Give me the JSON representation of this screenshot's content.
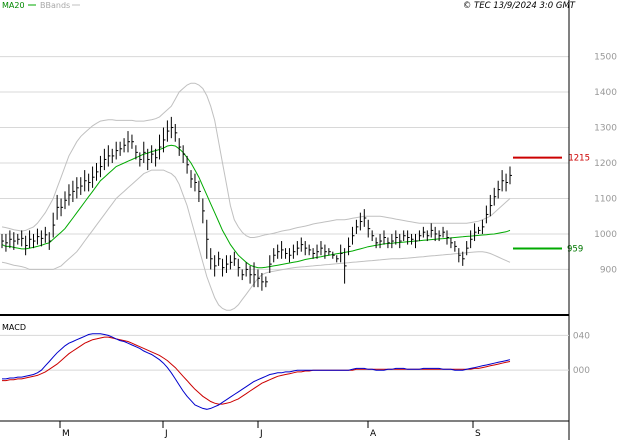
{
  "header": {
    "indicator_ma": "MA20",
    "indicator_bb": "BBands",
    "copyright": "© TEC 13/9/2024 3:0 GMT"
  },
  "price_axis": {
    "labels": [
      "1500",
      "1400",
      "1300",
      "1200",
      "1100",
      "1000",
      "900"
    ]
  },
  "markers": {
    "resistance_label": "1215",
    "support_label": "959",
    "resistance_color": "#cc0000",
    "support_color": "#00aa00"
  },
  "macd": {
    "label": "MACD",
    "axis_labels": [
      "040",
      "000"
    ]
  },
  "time_axis": {
    "labels": [
      "M",
      "J",
      "J",
      "A",
      "S"
    ]
  },
  "colors": {
    "ma20": "#00aa00",
    "bbands": "#c0c0c0",
    "macd_line": "#0000cc",
    "signal_line": "#cc0000",
    "bars": "#000000",
    "grid": "#d8d8d8"
  },
  "chart_data": {
    "type": "line",
    "title": "",
    "price_series_ohlc": [
      [
        1000,
        960
      ],
      [
        1000,
        950
      ],
      [
        1010,
        960
      ],
      [
        1005,
        955
      ],
      [
        1000,
        970
      ],
      [
        1010,
        965
      ],
      [
        995,
        940
      ],
      [
        1010,
        960
      ],
      [
        1000,
        960
      ],
      [
        1015,
        970
      ],
      [
        1010,
        965
      ],
      [
        1020,
        975
      ],
      [
        1005,
        955
      ],
      [
        1060,
        990
      ],
      [
        1110,
        1040
      ],
      [
        1100,
        1050
      ],
      [
        1120,
        1070
      ],
      [
        1140,
        1080
      ],
      [
        1150,
        1090
      ],
      [
        1160,
        1100
      ],
      [
        1160,
        1110
      ],
      [
        1180,
        1120
      ],
      [
        1170,
        1120
      ],
      [
        1190,
        1130
      ],
      [
        1200,
        1150
      ],
      [
        1220,
        1160
      ],
      [
        1240,
        1180
      ],
      [
        1250,
        1190
      ],
      [
        1240,
        1200
      ],
      [
        1260,
        1210
      ],
      [
        1260,
        1220
      ],
      [
        1270,
        1230
      ],
      [
        1290,
        1230
      ],
      [
        1280,
        1240
      ],
      [
        1250,
        1210
      ],
      [
        1230,
        1190
      ],
      [
        1260,
        1200
      ],
      [
        1240,
        1180
      ],
      [
        1250,
        1200
      ],
      [
        1240,
        1190
      ],
      [
        1280,
        1210
      ],
      [
        1300,
        1230
      ],
      [
        1320,
        1260
      ],
      [
        1330,
        1270
      ],
      [
        1310,
        1260
      ],
      [
        1270,
        1220
      ],
      [
        1250,
        1200
      ],
      [
        1220,
        1170
      ],
      [
        1180,
        1130
      ],
      [
        1170,
        1120
      ],
      [
        1150,
        1090
      ],
      [
        1100,
        1030
      ],
      [
        1040,
        930
      ],
      [
        960,
        900
      ],
      [
        940,
        880
      ],
      [
        950,
        910
      ],
      [
        930,
        880
      ],
      [
        940,
        890
      ],
      [
        940,
        900
      ],
      [
        950,
        910
      ],
      [
        930,
        880
      ],
      [
        900,
        870
      ],
      [
        920,
        880
      ],
      [
        910,
        860
      ],
      [
        920,
        850
      ],
      [
        900,
        850
      ],
      [
        890,
        840
      ],
      [
        880,
        850
      ],
      [
        940,
        890
      ],
      [
        960,
        920
      ],
      [
        970,
        930
      ],
      [
        980,
        930
      ],
      [
        960,
        930
      ],
      [
        960,
        920
      ],
      [
        970,
        930
      ],
      [
        980,
        940
      ],
      [
        990,
        950
      ],
      [
        980,
        940
      ],
      [
        970,
        940
      ],
      [
        960,
        930
      ],
      [
        970,
        930
      ],
      [
        980,
        940
      ],
      [
        970,
        930
      ],
      [
        960,
        940
      ],
      [
        950,
        930
      ],
      [
        940,
        920
      ],
      [
        970,
        920
      ],
      [
        960,
        860
      ],
      [
        990,
        940
      ],
      [
        1020,
        970
      ],
      [
        1040,
        1000
      ],
      [
        1060,
        1010
      ],
      [
        1070,
        1020
      ],
      [
        1040,
        990
      ],
      [
        1010,
        980
      ],
      [
        990,
        960
      ],
      [
        1000,
        960
      ],
      [
        1010,
        970
      ],
      [
        990,
        960
      ],
      [
        1000,
        960
      ],
      [
        1010,
        970
      ],
      [
        1000,
        960
      ],
      [
        1010,
        980
      ],
      [
        1010,
        970
      ],
      [
        1000,
        970
      ],
      [
        1000,
        960
      ],
      [
        1010,
        980
      ],
      [
        1020,
        990
      ],
      [
        1010,
        980
      ],
      [
        1030,
        990
      ],
      [
        1020,
        980
      ],
      [
        1010,
        980
      ],
      [
        1020,
        990
      ],
      [
        1010,
        970
      ],
      [
        990,
        960
      ],
      [
        980,
        950
      ],
      [
        960,
        920
      ],
      [
        950,
        910
      ],
      [
        980,
        940
      ],
      [
        1010,
        960
      ],
      [
        1030,
        980
      ],
      [
        1020,
        1000
      ],
      [
        1040,
        1000
      ],
      [
        1080,
        1030
      ],
      [
        1110,
        1050
      ],
      [
        1130,
        1080
      ],
      [
        1150,
        1100
      ],
      [
        1180,
        1120
      ],
      [
        1170,
        1120
      ],
      [
        1190,
        1140
      ]
    ],
    "ma20": [
      970,
      965,
      965,
      962,
      960,
      958,
      958,
      960,
      962,
      965,
      968,
      972,
      975,
      985,
      995,
      1005,
      1015,
      1030,
      1045,
      1060,
      1075,
      1090,
      1105,
      1120,
      1135,
      1150,
      1160,
      1170,
      1180,
      1190,
      1195,
      1200,
      1205,
      1210,
      1215,
      1220,
      1225,
      1228,
      1232,
      1235,
      1238,
      1242,
      1248,
      1250,
      1248,
      1240,
      1230,
      1215,
      1200,
      1180,
      1160,
      1135,
      1110,
      1085,
      1060,
      1035,
      1010,
      990,
      970,
      955,
      940,
      930,
      920,
      912,
      908,
      905,
      905,
      906,
      908,
      910,
      912,
      914,
      916,
      918,
      920,
      922,
      925,
      928,
      930,
      932,
      934,
      936,
      938,
      940,
      942,
      944,
      946,
      948,
      950,
      952,
      955,
      958,
      961,
      964,
      966,
      968,
      970,
      972,
      973,
      974,
      975,
      976,
      977,
      978,
      979,
      980,
      981,
      982,
      983,
      984,
      985,
      986,
      987,
      988,
      989,
      990,
      991,
      992,
      993,
      994,
      995,
      996,
      997,
      998,
      999,
      1000,
      1002,
      1004,
      1006,
      1010
    ],
    "bb_upper": [
      1020,
      1018,
      1015,
      1012,
      1010,
      1008,
      1010,
      1015,
      1020,
      1030,
      1045,
      1060,
      1080,
      1100,
      1130,
      1160,
      1190,
      1220,
      1240,
      1260,
      1275,
      1285,
      1295,
      1305,
      1312,
      1318,
      1320,
      1322,
      1322,
      1320,
      1320,
      1320,
      1320,
      1320,
      1318,
      1318,
      1318,
      1320,
      1322,
      1325,
      1330,
      1340,
      1350,
      1360,
      1380,
      1400,
      1410,
      1420,
      1425,
      1425,
      1420,
      1410,
      1390,
      1360,
      1320,
      1260,
      1200,
      1140,
      1080,
      1040,
      1020,
      1005,
      995,
      990,
      990,
      992,
      995,
      998,
      1000,
      1002,
      1005,
      1008,
      1010,
      1012,
      1015,
      1018,
      1020,
      1022,
      1025,
      1028,
      1030,
      1032,
      1034,
      1036,
      1038,
      1040,
      1040,
      1040,
      1042,
      1044,
      1046,
      1048,
      1050,
      1050,
      1050,
      1050,
      1050,
      1048,
      1046,
      1044,
      1042,
      1040,
      1038,
      1036,
      1034,
      1032,
      1030,
      1030,
      1030,
      1030,
      1030,
      1030,
      1030,
      1030,
      1030,
      1030,
      1030,
      1030,
      1030,
      1032,
      1034,
      1036,
      1040,
      1045,
      1050,
      1060,
      1070,
      1080,
      1090,
      1100
    ],
    "bb_lower": [
      920,
      918,
      915,
      912,
      910,
      908,
      905,
      900,
      900,
      900,
      900,
      900,
      900,
      900,
      905,
      910,
      920,
      930,
      940,
      950,
      965,
      980,
      995,
      1010,
      1025,
      1040,
      1055,
      1070,
      1085,
      1100,
      1110,
      1120,
      1130,
      1140,
      1150,
      1160,
      1170,
      1175,
      1180,
      1180,
      1180,
      1180,
      1175,
      1170,
      1160,
      1140,
      1110,
      1080,
      1040,
      1000,
      960,
      920,
      880,
      850,
      820,
      800,
      790,
      785,
      785,
      790,
      800,
      815,
      830,
      845,
      860,
      875,
      885,
      890,
      893,
      895,
      897,
      899,
      901,
      903,
      905,
      906,
      907,
      908,
      909,
      910,
      911,
      912,
      913,
      914,
      915,
      916,
      917,
      918,
      919,
      920,
      921,
      922,
      923,
      924,
      925,
      926,
      927,
      928,
      929,
      930,
      930,
      930,
      931,
      932,
      933,
      934,
      935,
      936,
      937,
      938,
      939,
      940,
      941,
      942,
      943,
      944,
      945,
      946,
      947,
      948,
      949,
      950,
      950,
      948,
      945,
      940,
      935,
      930,
      925,
      920
    ],
    "macd": [
      -10,
      -10,
      -9,
      -9,
      -8,
      -8,
      -7,
      -6,
      -5,
      -3,
      0,
      5,
      10,
      15,
      20,
      24,
      28,
      31,
      33,
      35,
      37,
      39,
      41,
      42,
      42,
      42,
      41,
      40,
      38,
      36,
      34,
      33,
      31,
      29,
      27,
      25,
      22,
      20,
      18,
      15,
      12,
      8,
      3,
      -3,
      -10,
      -17,
      -24,
      -30,
      -35,
      -40,
      -42,
      -44,
      -45,
      -44,
      -42,
      -40,
      -37,
      -34,
      -31,
      -28,
      -25,
      -22,
      -19,
      -16,
      -13,
      -11,
      -9,
      -7,
      -5,
      -4,
      -3,
      -3,
      -2,
      -2,
      -1,
      0,
      0,
      0,
      0,
      0,
      0,
      0,
      0,
      0,
      0,
      0,
      0,
      0,
      0,
      1,
      2,
      2,
      2,
      1,
      1,
      0,
      0,
      0,
      1,
      1,
      2,
      2,
      2,
      1,
      1,
      1,
      1,
      2,
      2,
      2,
      2,
      2,
      1,
      1,
      1,
      0,
      0,
      0,
      1,
      2,
      3,
      4,
      5,
      6,
      7,
      8,
      9,
      10,
      11,
      12
    ],
    "signal": [
      -12,
      -12,
      -11,
      -11,
      -10,
      -10,
      -9,
      -8,
      -7,
      -6,
      -4,
      -2,
      1,
      4,
      7,
      11,
      15,
      19,
      22,
      25,
      28,
      31,
      33,
      35,
      36,
      37,
      38,
      38,
      37,
      36,
      35,
      34,
      33,
      31,
      29,
      27,
      25,
      23,
      21,
      19,
      17,
      14,
      11,
      7,
      3,
      -2,
      -7,
      -12,
      -17,
      -22,
      -26,
      -30,
      -33,
      -36,
      -38,
      -39,
      -39,
      -38,
      -37,
      -35,
      -33,
      -30,
      -27,
      -24,
      -21,
      -18,
      -15,
      -13,
      -11,
      -9,
      -7,
      -6,
      -5,
      -4,
      -3,
      -2,
      -2,
      -1,
      -1,
      0,
      0,
      0,
      0,
      0,
      0,
      0,
      0,
      0,
      0,
      0,
      1,
      1,
      1,
      1,
      1,
      1,
      1,
      1,
      1,
      1,
      1,
      1,
      1,
      1,
      1,
      1,
      1,
      1,
      1,
      1,
      1,
      1,
      1,
      1,
      1,
      1,
      1,
      1,
      1,
      1,
      2,
      2,
      3,
      4,
      5,
      6,
      7,
      8,
      9,
      10
    ],
    "price_ylim": [
      780,
      1620
    ],
    "macd_ylim": [
      -55,
      60
    ],
    "price_ticks": [
      1500,
      1400,
      1300,
      1200,
      1100,
      1000,
      900
    ],
    "macd_ticks": [
      40,
      0
    ],
    "resistance_value": 1215,
    "support_value": 959
  }
}
